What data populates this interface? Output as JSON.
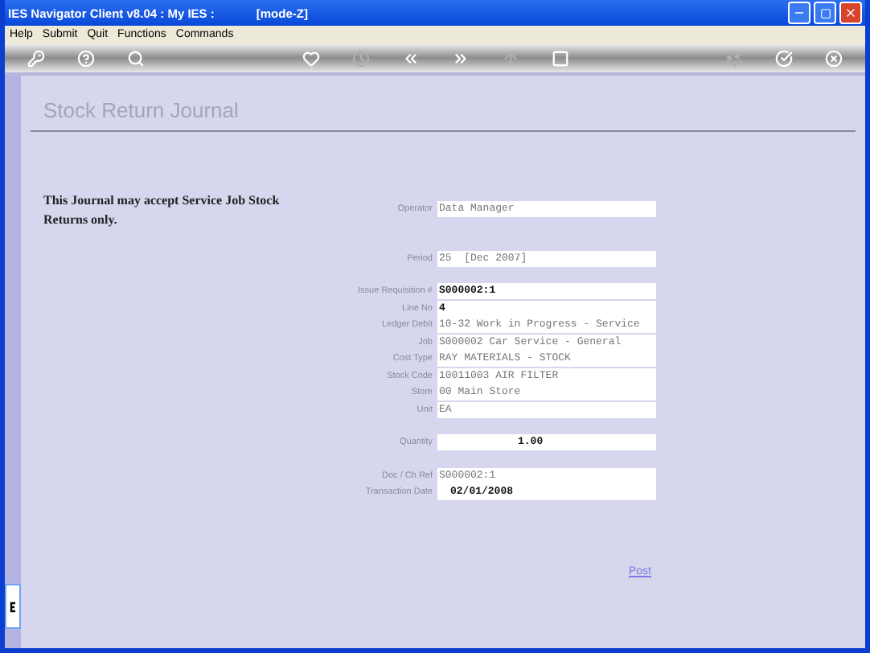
{
  "window": {
    "title": "IES Navigator Client v8.04 : My IES :",
    "mode": "[mode-Z]"
  },
  "menu": [
    "Help",
    "Submit",
    "Quit",
    "Functions",
    "Commands"
  ],
  "toolbar": [
    {
      "kind": "key",
      "disabled": false
    },
    {
      "kind": "help",
      "disabled": false
    },
    {
      "kind": "search",
      "disabled": false
    },
    {
      "kind": "spacer"
    },
    {
      "kind": "heart",
      "disabled": false
    },
    {
      "kind": "clock",
      "disabled": true
    },
    {
      "kind": "back",
      "disabled": false
    },
    {
      "kind": "forward",
      "disabled": false
    },
    {
      "kind": "up",
      "disabled": true
    },
    {
      "kind": "square",
      "disabled": false
    },
    {
      "kind": "spacer"
    },
    {
      "kind": "recycle",
      "disabled": true
    },
    {
      "kind": "check",
      "disabled": false
    },
    {
      "kind": "close",
      "disabled": false
    }
  ],
  "page_title": "Stock Return Journal",
  "note": "This Journal may accept Service Job Stock Returns only.",
  "groups": [
    [
      {
        "label": "Operator",
        "value": "Data Manager",
        "kind": "display"
      }
    ],
    [
      {
        "label": "Period",
        "value": "25  [Dec 2007]",
        "kind": "display"
      }
    ],
    [
      {
        "label": "Issue Requisition #",
        "value": "S000002:1",
        "kind": "input"
      },
      {
        "label": "Line No",
        "value": "4",
        "kind": "input"
      },
      {
        "label": "Ledger Debit",
        "value": "10-32 Work in Progress - Service",
        "kind": "display"
      },
      {
        "label": "Job",
        "value": "S000002 Car Service - General",
        "kind": "display"
      },
      {
        "label": "Cost Type",
        "value": "RAY MATERIALS - STOCK",
        "kind": "display"
      },
      {
        "label": "Stock Code",
        "value": "10011003 AIR FILTER",
        "kind": "display"
      },
      {
        "label": "Store",
        "value": "00 Main Store",
        "kind": "display"
      },
      {
        "label": "Unit",
        "value": "EA",
        "kind": "display"
      }
    ],
    [
      {
        "label": "Quantity",
        "value": "1.00",
        "kind": "number"
      }
    ],
    [
      {
        "label": "Doc / Ch Ref",
        "value": "S000002:1",
        "kind": "display"
      },
      {
        "label": "Transaction Date",
        "value": "02/01/2008",
        "kind": "date"
      }
    ]
  ],
  "post_link": "Post"
}
